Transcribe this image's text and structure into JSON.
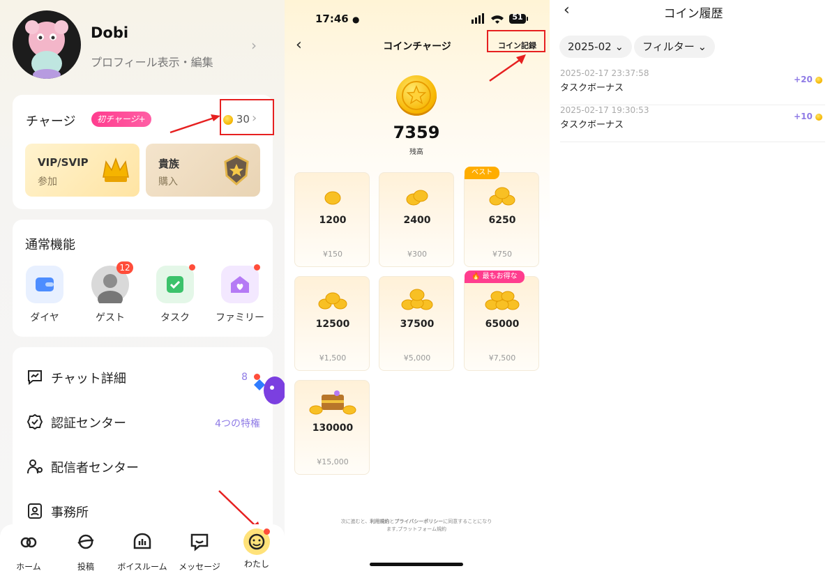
{
  "profile": {
    "name": "Dobi",
    "subtitle": "プロフィール表示・編集"
  },
  "charge": {
    "title": "チャージ",
    "badge": "初チャージ+",
    "coins": "30",
    "vip": {
      "title": "VIP/SVIP",
      "sub": "参加"
    },
    "noble": {
      "title": "貴族",
      "sub": "購入"
    }
  },
  "functions": {
    "title": "通常機能",
    "items": [
      {
        "label": "ダイヤ",
        "icon": "wallet-icon"
      },
      {
        "label": "ゲスト",
        "icon": "guest-avatar",
        "badge": "12"
      },
      {
        "label": "タスク",
        "icon": "calendar-check-icon"
      },
      {
        "label": "ファミリー",
        "icon": "family-house-icon"
      }
    ]
  },
  "menu": [
    {
      "label": "チャット詳細",
      "icon": "chat-chart-icon",
      "extra": "8"
    },
    {
      "label": "認証センター",
      "icon": "verified-badge-icon",
      "extra": "4つの特権"
    },
    {
      "label": "配信者センター",
      "icon": "streamer-icon",
      "extra": ""
    },
    {
      "label": "事務所",
      "icon": "agency-icon",
      "extra": ""
    }
  ],
  "tabbar": [
    {
      "label": "ホーム",
      "icon": "home-icon"
    },
    {
      "label": "投稿",
      "icon": "planet-icon"
    },
    {
      "label": "ボイスルーム",
      "icon": "voice-room-icon"
    },
    {
      "label": "メッセージ",
      "icon": "message-icon"
    },
    {
      "label": "わたし",
      "icon": "me-smiley-icon"
    }
  ],
  "charge_screen": {
    "time": "17:46",
    "battery": "51",
    "title": "コインチャージ",
    "record": "コイン記録",
    "balance": "7359",
    "balance_label": "残高",
    "packages": [
      {
        "amount": "1200",
        "price": "¥150",
        "tag": ""
      },
      {
        "amount": "2400",
        "price": "¥300",
        "tag": ""
      },
      {
        "amount": "6250",
        "price": "¥750",
        "tag": "ベスト"
      },
      {
        "amount": "12500",
        "price": "¥1,500",
        "tag": ""
      },
      {
        "amount": "37500",
        "price": "¥5,000",
        "tag": ""
      },
      {
        "amount": "65000",
        "price": "¥7,500",
        "tag": "最もお得な"
      },
      {
        "amount": "130000",
        "price": "¥15,000",
        "tag": ""
      }
    ],
    "terms_pre": "次に進むと、",
    "terms_link1": "利用規約",
    "terms_and": "と",
    "terms_link2": "プライバシーポリシー",
    "terms_post": "に同意することになります,",
    "terms_link3": "プラットフォーム規約"
  },
  "history": {
    "title": "コイン履歴",
    "month": "2025-02",
    "filter": "フィルター",
    "rows": [
      {
        "date": "2025-02-17 23:37:58",
        "desc": "タスクボーナス",
        "amount": "+20"
      },
      {
        "date": "2025-02-17 19:30:53",
        "desc": "タスクボーナス",
        "amount": "+10"
      }
    ]
  },
  "colors": {
    "accent_purple": "#8f7be6",
    "badge_pink": "#ff3d8e",
    "annotation_red": "#e62020",
    "coin_gold": "#f4b400"
  }
}
